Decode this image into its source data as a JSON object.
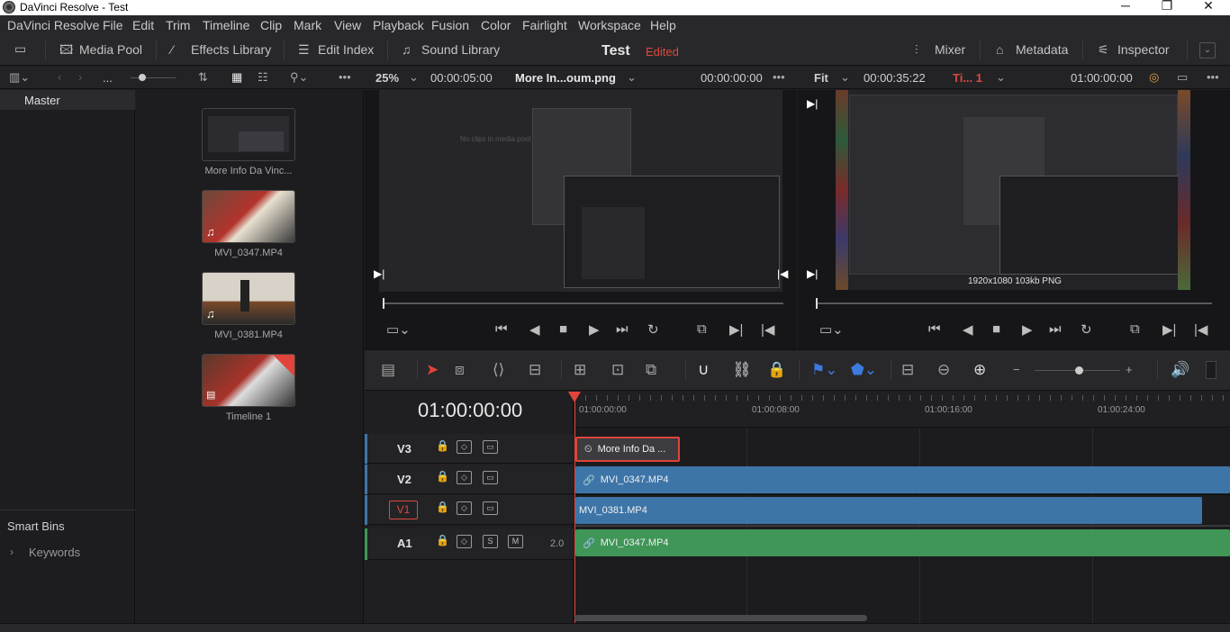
{
  "window": {
    "title": "DaVinci Resolve - Test",
    "minimize": "─",
    "restore": "❐",
    "close": "✕"
  },
  "menu": [
    "DaVinci Resolve",
    "File",
    "Edit",
    "Trim",
    "Timeline",
    "Clip",
    "Mark",
    "View",
    "Playback",
    "Fusion",
    "Color",
    "Fairlight",
    "Workspace",
    "Help"
  ],
  "toolbar": {
    "media_pool": "Media Pool",
    "effects_library": "Effects Library",
    "edit_index": "Edit Index",
    "sound_library": "Sound Library",
    "project_name": "Test",
    "project_status": "Edited",
    "mixer": "Mixer",
    "metadata": "Metadata",
    "inspector": "Inspector",
    "status_color": "#d94a3d"
  },
  "subbar": {
    "ellipsis": "...",
    "zoom": "25%",
    "source_duration": "00:00:05:00",
    "source_clip": "More In...oum.png",
    "source_timecode": "00:00:00:00",
    "fit": "Fit",
    "timeline_duration": "00:00:35:22",
    "timeline_name": "Ti... 1",
    "timeline_timecode": "01:00:00:00"
  },
  "bins": {
    "master": "Master",
    "smart_bins": "Smart Bins",
    "keywords": "Keywords"
  },
  "pool": {
    "clips": [
      {
        "name": "More Info Da Vinc...",
        "kind": "image"
      },
      {
        "name": "MVI_0347.MP4",
        "kind": "video-audio"
      },
      {
        "name": "MVI_0381.MP4",
        "kind": "video-audio"
      },
      {
        "name": "Timeline 1",
        "kind": "timeline"
      }
    ]
  },
  "viewer": {
    "source_text": "No clips in media pool",
    "resolution_label": "1920x1080 103kb PNG"
  },
  "timeline": {
    "current_tc": "01:00:00:00",
    "ruler": [
      "01:00:00:00",
      "01:00:08:00",
      "01:00:16:00",
      "01:00:24:00"
    ],
    "tracks": [
      {
        "name": "V3",
        "clip": "More Info Da ...",
        "color": "#3b3b40"
      },
      {
        "name": "V2",
        "clip": "MVI_0347.MP4",
        "color": "#3e75a8"
      },
      {
        "name": "V1",
        "clip": "MVI_0381.MP4",
        "color": "#3e75a8"
      },
      {
        "name": "A1",
        "clip": "MVI_0347.MP4",
        "color": "#3f9657",
        "level": "2.0",
        "solo": "S",
        "mute": "M"
      }
    ]
  }
}
